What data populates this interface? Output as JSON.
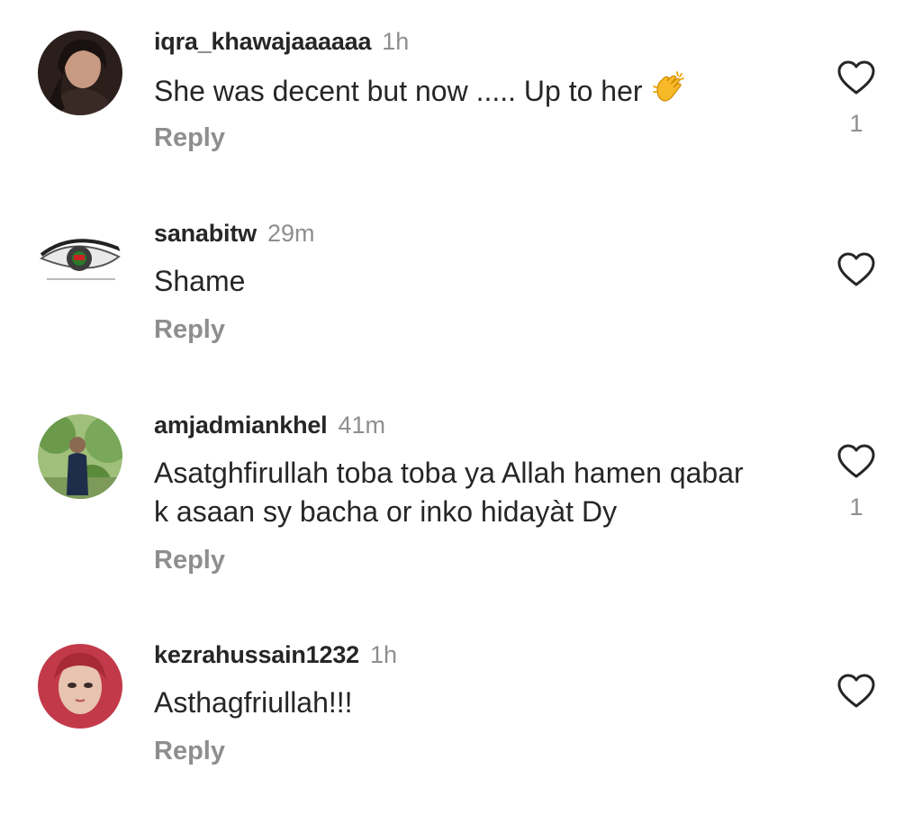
{
  "comments": [
    {
      "username": "iqra_khawajaaaaaa",
      "time": "1h",
      "text": "She was decent but now ..... Up to her",
      "emoji": "clapping-hands-icon",
      "reply_label": "Reply",
      "likes": "1"
    },
    {
      "username": "sanabitw",
      "time": "29m",
      "text": "Shame",
      "reply_label": "Reply",
      "likes": ""
    },
    {
      "username": "amjadmiankhel",
      "time": "41m",
      "text": "Asatghfirullah toba toba ya Allah hamen qabar k asaan sy bacha or inko hidayàt Dy",
      "reply_label": "Reply",
      "likes": "1"
    },
    {
      "username": "kezrahussain1232",
      "time": "1h",
      "text": "Asthagfriullah!!!",
      "reply_label": "Reply",
      "likes": ""
    }
  ],
  "colors": {
    "text": "#262626",
    "secondary": "#8e8e8e",
    "background": "#ffffff"
  }
}
